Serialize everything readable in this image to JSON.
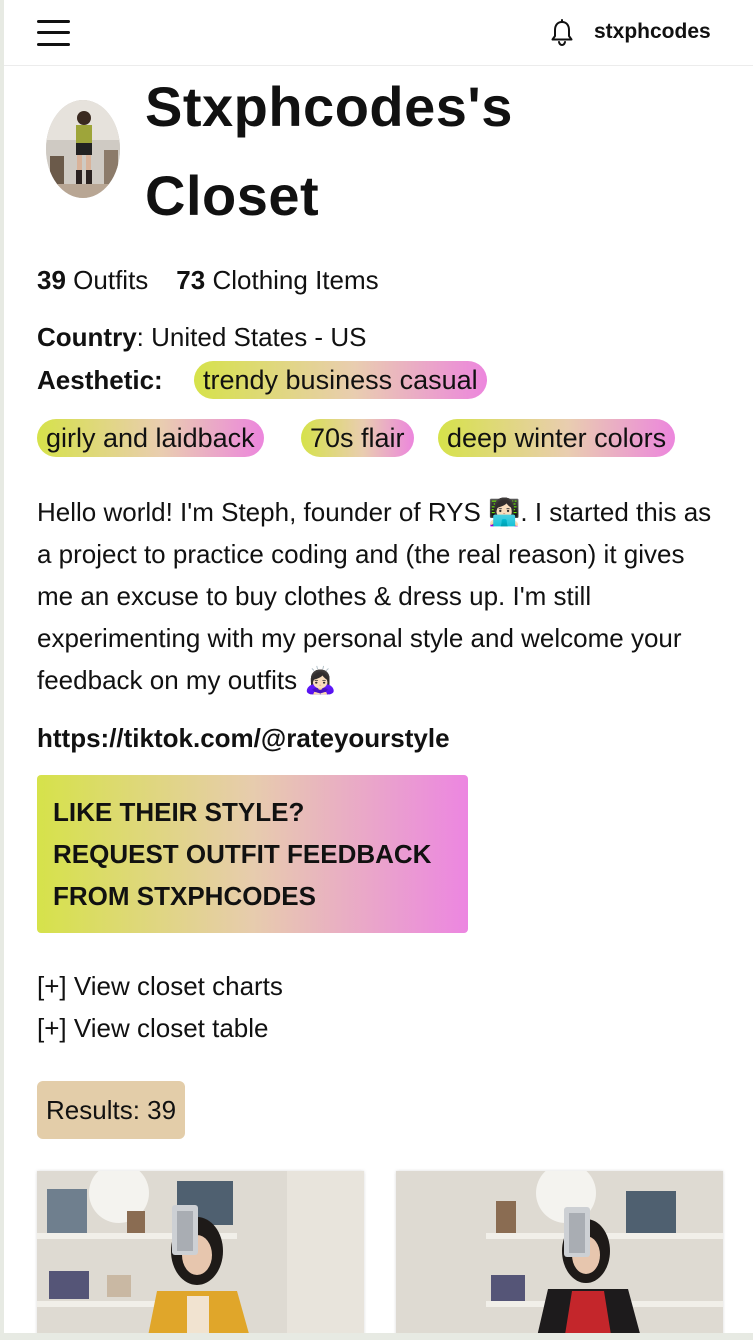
{
  "header": {
    "username": "stxphcodes"
  },
  "profile": {
    "title_line1": "Stxphcodes's",
    "title_line2": "Closet",
    "outfits_count": "39",
    "outfits_label": "Outfits",
    "items_count": "73",
    "items_label": "Clothing Items",
    "country_label": "Country",
    "country_value": ": United States - US",
    "aesthetic_label": "Aesthetic:",
    "aesthetics": [
      "trendy business casual",
      "girly and laidback",
      "70s flair",
      "deep winter colors"
    ],
    "bio": "Hello world! I'm Steph, founder of RYS 👩🏻‍💻. I started this as a project to practice coding and (the real reason) it gives me an excuse to buy clothes & dress up. I'm still experimenting with my personal style and welcome your feedback on my outfits 🙇🏻‍♀️",
    "link": "https://tiktok.com/@rateyourstyle"
  },
  "cta": {
    "line1": "LIKE THEIR STYLE?",
    "line2": "REQUEST OUTFIT FEEDBACK",
    "line3": "FROM STXPHCODES"
  },
  "toggles": {
    "charts": "[+] View closet charts",
    "table": "[+] View closet table"
  },
  "results": {
    "label": "Results: 39"
  },
  "colors": {
    "tag_gradient_start": "#d6e24a",
    "tag_gradient_end": "#ec86dd",
    "results_bg": "#e3cda9"
  },
  "icons": {
    "menu": "hamburger-menu-icon",
    "notifications": "bell-icon"
  }
}
